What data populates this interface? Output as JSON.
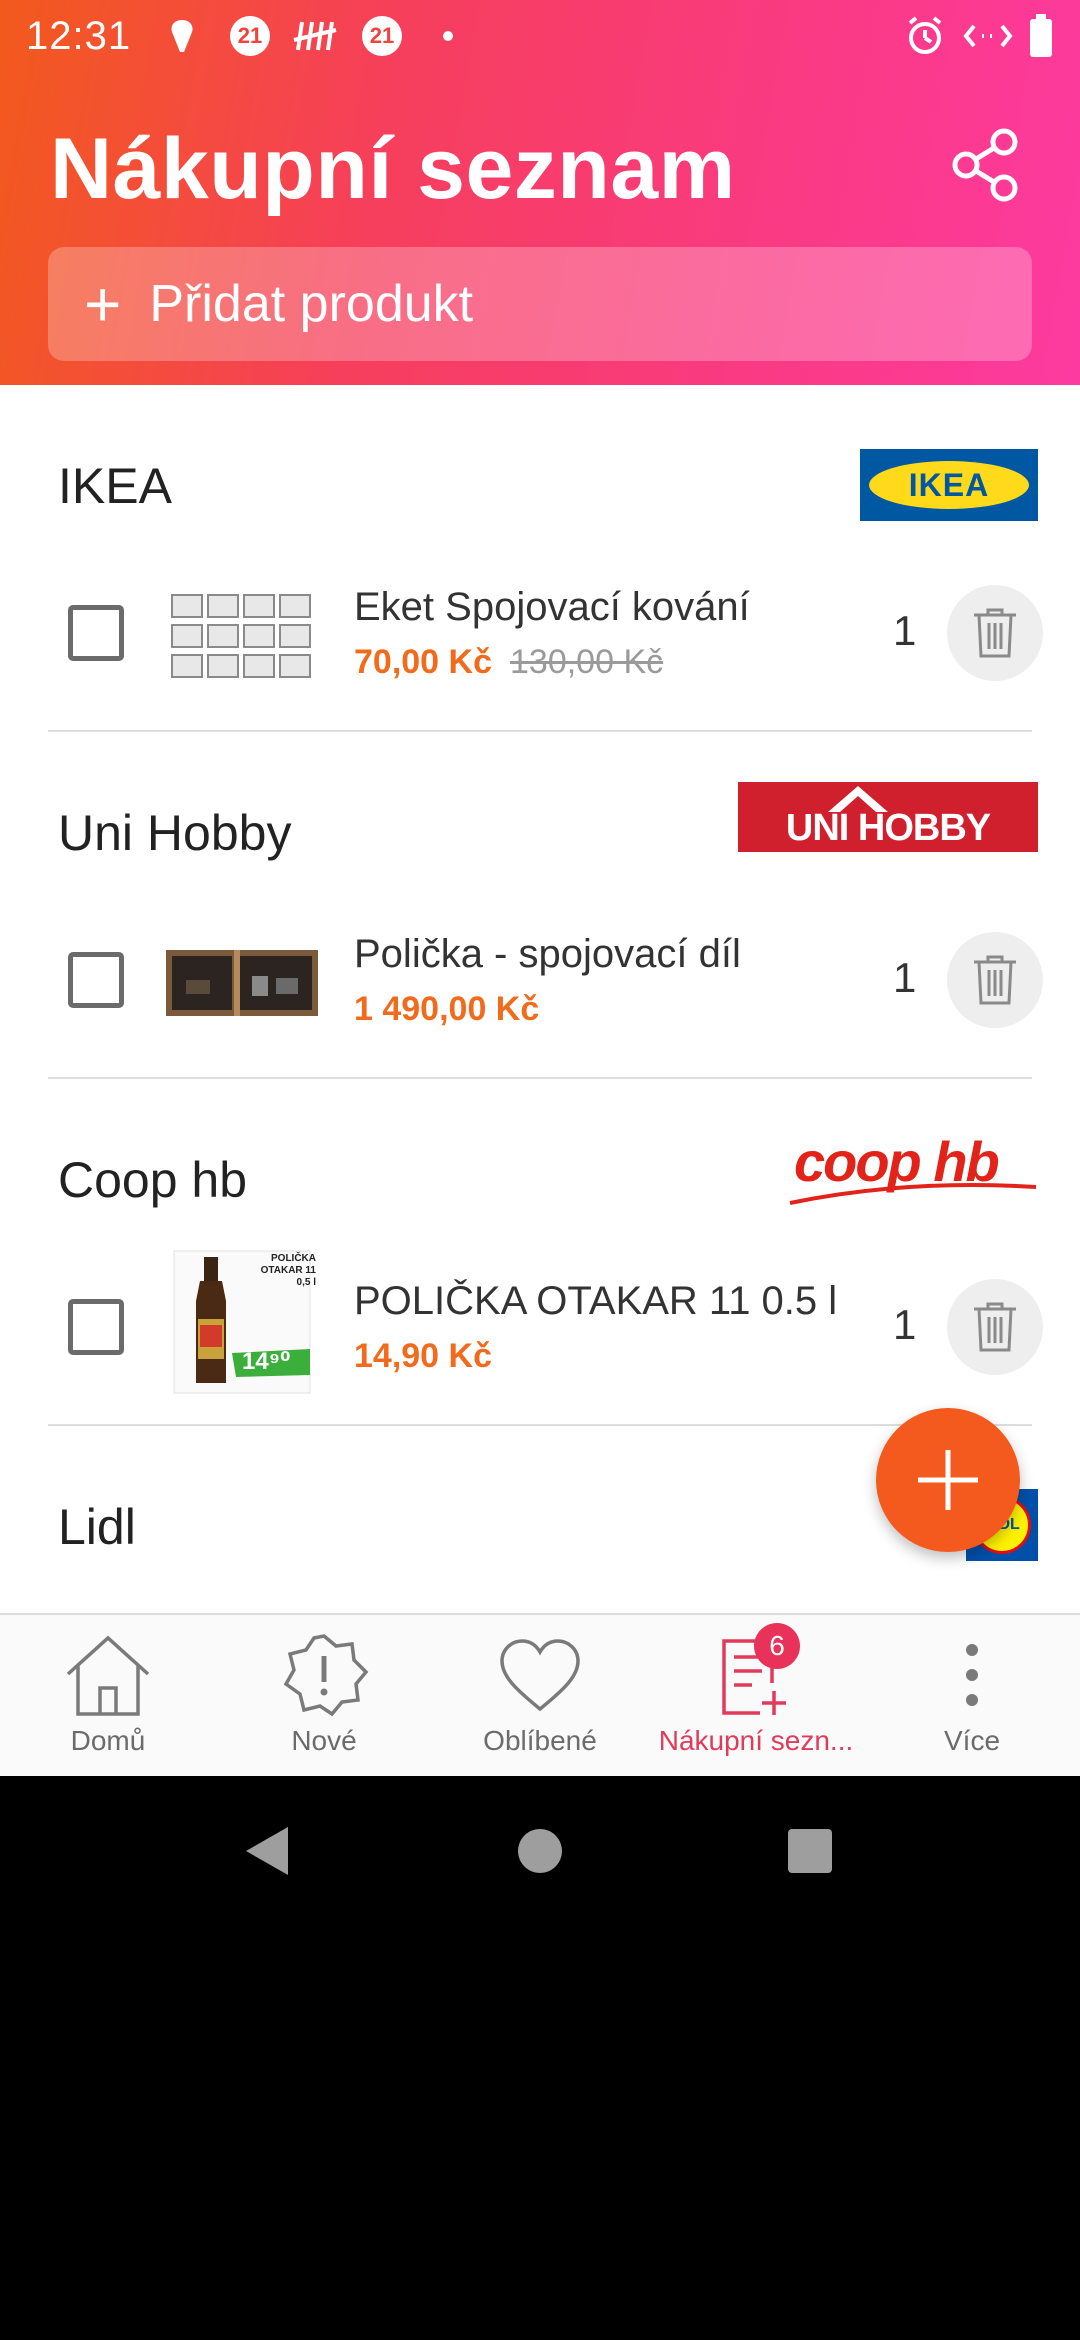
{
  "status_bar": {
    "time": "12:31",
    "notification_badges": [
      "21",
      "21"
    ]
  },
  "header": {
    "title": "Nákupní seznam",
    "add_product_label": "Přidat produkt"
  },
  "stores": [
    {
      "name": "IKEA",
      "logo_text": "IKEA",
      "items": [
        {
          "name": "Eket Spojovací kování",
          "price": "70,00 Kč",
          "old_price": "130,00 Kč",
          "quantity": "1"
        }
      ]
    },
    {
      "name": "Uni Hobby",
      "logo_text": "UNI HOBBY",
      "items": [
        {
          "name": "Polička - spojovací díl",
          "price": "1 490,00 Kč",
          "old_price": "",
          "quantity": "1"
        }
      ]
    },
    {
      "name": "Coop hb",
      "logo_text": "coop hb",
      "items": [
        {
          "name": "POLIČKA OTAKAR 11 0.5 l",
          "price": "14,90 Kč",
          "old_price": "",
          "quantity": "1"
        }
      ]
    },
    {
      "name": "Lidl",
      "logo_text": "LIDL",
      "items": []
    }
  ],
  "thumb_texts": {
    "coop_label_line1": "POLIČKA",
    "coop_label_line2": "OTAKAR 11",
    "coop_label_line3": "0,5 l",
    "coop_price": "14⁹⁰"
  },
  "bottom_nav": [
    {
      "label": "Domů",
      "icon": "home-icon"
    },
    {
      "label": "Nové",
      "icon": "new-icon"
    },
    {
      "label": "Oblíbené",
      "icon": "heart-icon"
    },
    {
      "label": "Nákupní sezn...",
      "icon": "shopping-list-icon",
      "badge": "6",
      "active": true
    },
    {
      "label": "Více",
      "icon": "more-icon"
    }
  ],
  "colors": {
    "accent_orange": "#f26a1b",
    "accent_pink": "#e23a5b",
    "ikea_blue": "#0058a3",
    "ikea_yellow": "#ffda1a",
    "unihobby_red": "#d0202e",
    "coop_red": "#e2231a"
  }
}
